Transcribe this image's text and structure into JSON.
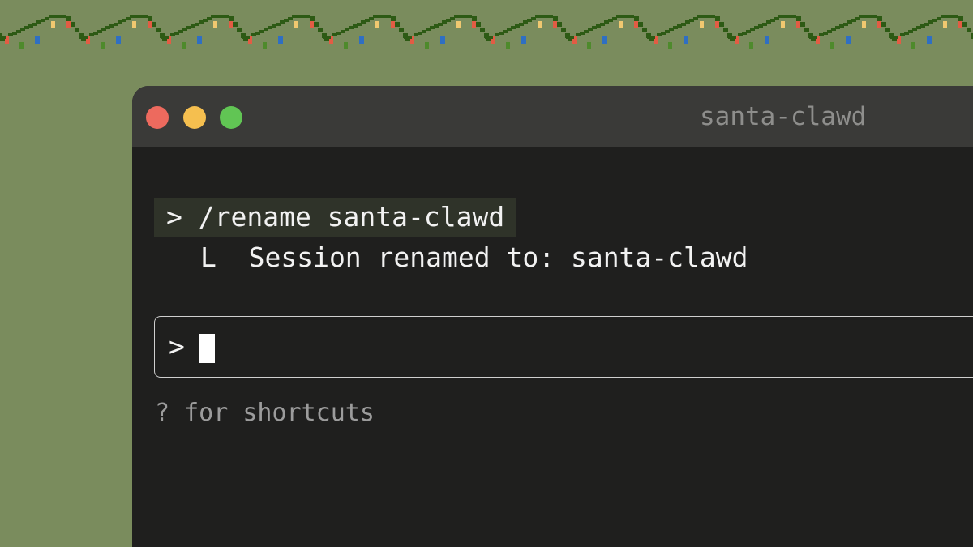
{
  "window": {
    "title": "santa-clawd",
    "title_color": "#8e8e8c",
    "controls": [
      {
        "name": "close-button",
        "color": "#ed6a5e"
      },
      {
        "name": "minimize-button",
        "color": "#f5bf4f"
      },
      {
        "name": "zoom-button",
        "color": "#61c554"
      }
    ]
  },
  "terminal": {
    "command": "> /rename santa-clawd",
    "response": "L  Session renamed to: santa-clawd",
    "prompt_glyph": ">",
    "hint": "? for shortcuts"
  },
  "decoration": {
    "background_color": "#7a8c5d",
    "garland_color": "#2d5a14",
    "bulb_colors": [
      "#f0c870",
      "#e25c44",
      "#e25c44",
      "#2f6fc2",
      "#4e8a2c"
    ]
  }
}
